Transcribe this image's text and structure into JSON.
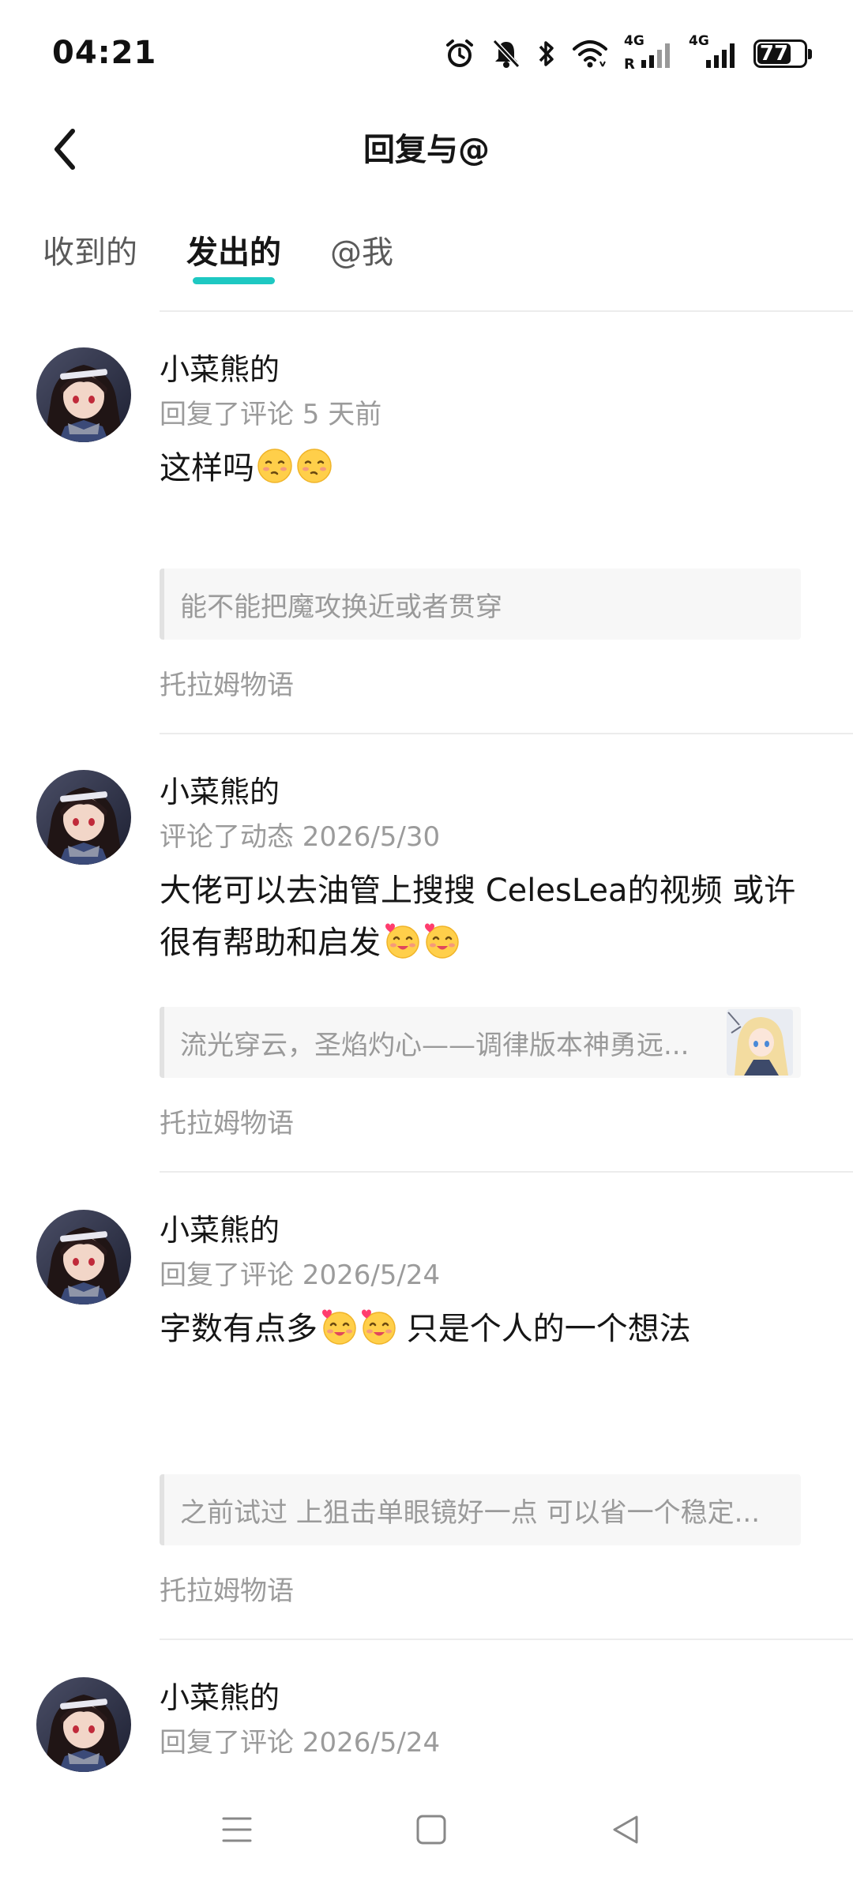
{
  "status_bar": {
    "time": "04:21",
    "icons": [
      "alarm-icon",
      "mute-bell-icon",
      "bluetooth-icon",
      "wifi-icon",
      "signal-4g-roaming-icon",
      "signal-4g-icon"
    ],
    "network_label_1": "4G",
    "network_roaming": "R",
    "network_label_2": "4G",
    "battery_level": "77"
  },
  "header": {
    "back_icon": "chevron-left-icon",
    "title": "回复与@"
  },
  "tabs": [
    {
      "label": "收到的",
      "active": false
    },
    {
      "label": "发出的",
      "active": true
    },
    {
      "label": "@我",
      "active": false
    }
  ],
  "accent_color": "#1ec8c2",
  "items": [
    {
      "name": "小菜熊的",
      "meta": "回复了评论 5 天前",
      "text": "这样吗",
      "emojis": [
        "shy-face-emoji",
        "shy-face-emoji"
      ],
      "quote": "能不能把魔攻换近或者贯穿",
      "source": "托拉姆物语"
    },
    {
      "name": "小菜熊的",
      "meta": "评论了动态 2026/5/30",
      "text_line1": "大佬可以去油管上搜搜 CelesLea的视频 或许",
      "text_line2": "很有帮助和启发",
      "emojis": [
        "heart-blush-face-emoji",
        "heart-blush-face-emoji"
      ],
      "quote": "流光穿云，圣焰灼心——调律版本神勇远...",
      "quote_thumbnail": "anime-girl-thumbnail",
      "source": "托拉姆物语"
    },
    {
      "name": "小菜熊的",
      "meta": "回复了评论 2026/5/24",
      "text_before": "字数有点多",
      "text_after": " 只是个人的一个想法",
      "emojis": [
        "heart-blush-face-emoji",
        "heart-blush-face-emoji"
      ],
      "quote": "之前试过 上狙击单眼镜好一点 可以省一个稳定...",
      "source": "托拉姆物语"
    },
    {
      "name": "小菜熊的",
      "meta": "回复了评论 2026/5/24"
    }
  ],
  "nav_bar": {
    "buttons": [
      "menu-icon",
      "home-square-icon",
      "back-triangle-icon"
    ]
  }
}
